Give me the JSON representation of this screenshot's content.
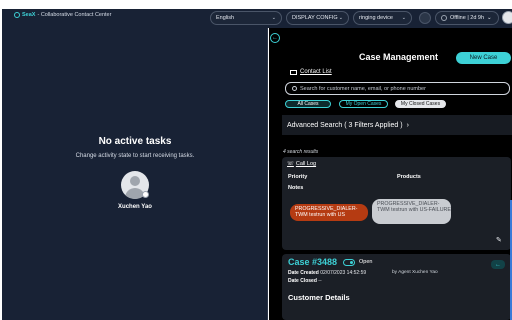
{
  "topbar": {
    "brand_prefix": "SeaX",
    "brand_suffix": " - Collaborative Contact Center",
    "language": "English",
    "display_config": "DISPLAY CONFIG",
    "device": "ringing device",
    "status": "Offline | 2d 9h"
  },
  "left": {
    "title": "No active tasks",
    "subtitle": "Change activity state to start receiving tasks.",
    "agent_name": "Xuchen Yao"
  },
  "case_management": {
    "title": "Case Management",
    "new_case": "New Case",
    "contact_list": "Contact List",
    "search_placeholder": "Search for customer name, email, or phone number",
    "filters": [
      "All Cases",
      "My Open Cases",
      "My Closed Cases"
    ],
    "advanced_search": "Advanced Search ( 3 Filters Applied )",
    "results": "4 search results"
  },
  "card1": {
    "call_log": "Call Log",
    "priority": "Priority",
    "products": "Products",
    "notes": "Notes",
    "tag_red": "PROGRESSIVE_DIALER-TWM testrun with US",
    "tag_grey": "PROGRESSIVE_DIALER-TWM testrun with US-FAILURE"
  },
  "card2": {
    "case_number": "Case #3488",
    "state": "Open",
    "date_created_label": "Date Created",
    "date_created": "02/07/2023 14:52:59",
    "by_agent": "by Agent Xuchen Yao",
    "date_closed_label": "Date Closed",
    "date_closed": "--",
    "customer_details": "Customer Details"
  },
  "colors": {
    "accent": "#3dd1d6",
    "panel": "#182235",
    "danger": "#b53b12"
  }
}
